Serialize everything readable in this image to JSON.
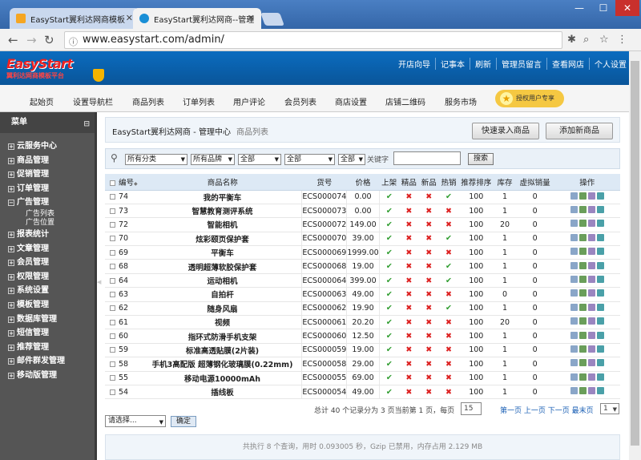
{
  "browser": {
    "tabs": [
      {
        "label": "EasyStart翼利达网商模板",
        "active": false
      },
      {
        "label": "EasyStart翼利达网商--管理",
        "active": true
      }
    ],
    "url": "www.easystart.com/admin/"
  },
  "header": {
    "logo_text": "EasyStart",
    "logo_sub": "翼利达网商模板平台",
    "links": [
      "开店向导",
      "记事本",
      "刷新",
      "管理员留言",
      "查看网店",
      "个人设置"
    ]
  },
  "menu": {
    "items": [
      "起始页",
      "设置导航栏",
      "商品列表",
      "订单列表",
      "用户评论",
      "会员列表",
      "商店设置",
      "店铺二维码",
      "服务市场"
    ],
    "vip_label": "授权用户专享"
  },
  "sidebar": {
    "title": "菜单",
    "items": [
      {
        "label": "云服务中心"
      },
      {
        "label": "商品管理"
      },
      {
        "label": "促销管理"
      },
      {
        "label": "订单管理"
      },
      {
        "label": "广告管理",
        "children": [
          "广告列表",
          "广告位置"
        ]
      },
      {
        "label": "报表统计"
      },
      {
        "label": "文章管理"
      },
      {
        "label": "会员管理"
      },
      {
        "label": "权限管理"
      },
      {
        "label": "系统设置"
      },
      {
        "label": "模板管理"
      },
      {
        "label": "数据库管理"
      },
      {
        "label": "短信管理"
      },
      {
        "label": "推荐管理"
      },
      {
        "label": "邮件群发管理"
      },
      {
        "label": "移动版管理"
      }
    ]
  },
  "page": {
    "title": "EasyStart翼利达网商 - 管理中心",
    "subtitle": "商品列表",
    "btn_quick": "快速录入商品",
    "btn_add": "添加新商品"
  },
  "filter": {
    "category": "所有分类",
    "brand": "所有品牌",
    "sel3": "全部",
    "sel4": "全部",
    "sel5": "全部",
    "keyword_label": "关键字",
    "keyword_value": "",
    "search_label": "搜索"
  },
  "table": {
    "headers": [
      "编号",
      "商品名称",
      "货号",
      "价格",
      "上架",
      "精品",
      "新品",
      "热销",
      "推荐排序",
      "库存",
      "虚拟销量",
      "操作"
    ],
    "rows": [
      {
        "id": "74",
        "name": "我的平衡车",
        "sn": "ECS000074",
        "price": "0.00",
        "onsale": true,
        "best": false,
        "new": false,
        "hot": true,
        "sort": "100",
        "stock": "1",
        "virtual": "0"
      },
      {
        "id": "73",
        "name": "智慧教育测评系统",
        "sn": "ECS000073",
        "price": "0.00",
        "onsale": true,
        "best": false,
        "new": false,
        "hot": false,
        "sort": "100",
        "stock": "1",
        "virtual": "0"
      },
      {
        "id": "72",
        "name": "智能相机",
        "sn": "ECS000072",
        "price": "149.00",
        "onsale": true,
        "best": false,
        "new": false,
        "hot": false,
        "sort": "100",
        "stock": "20",
        "virtual": "0"
      },
      {
        "id": "70",
        "name": "炫彩颐页保护套",
        "sn": "ECS000070",
        "price": "39.00",
        "onsale": true,
        "best": false,
        "new": false,
        "hot": true,
        "sort": "100",
        "stock": "1",
        "virtual": "0"
      },
      {
        "id": "69",
        "name": "平衡车",
        "sn": "ECS000069",
        "price": "1999.00",
        "onsale": true,
        "best": false,
        "new": false,
        "hot": false,
        "sort": "100",
        "stock": "1",
        "virtual": "0"
      },
      {
        "id": "68",
        "name": "透明超薄软胶保护套",
        "sn": "ECS000068",
        "price": "19.00",
        "onsale": true,
        "best": false,
        "new": false,
        "hot": true,
        "sort": "100",
        "stock": "1",
        "virtual": "0"
      },
      {
        "id": "64",
        "name": "运动相机",
        "sn": "ECS000064",
        "price": "399.00",
        "onsale": true,
        "best": false,
        "new": false,
        "hot": true,
        "sort": "100",
        "stock": "1",
        "virtual": "0"
      },
      {
        "id": "63",
        "name": "自拍杆",
        "sn": "ECS000063",
        "price": "49.00",
        "onsale": true,
        "best": false,
        "new": false,
        "hot": false,
        "sort": "100",
        "stock": "0",
        "virtual": "0"
      },
      {
        "id": "62",
        "name": "随身风扇",
        "sn": "ECS000062",
        "price": "19.90",
        "onsale": true,
        "best": false,
        "new": false,
        "hot": true,
        "sort": "100",
        "stock": "1",
        "virtual": "0"
      },
      {
        "id": "61",
        "name": "视频",
        "sn": "ECS000061",
        "price": "20.20",
        "onsale": true,
        "best": false,
        "new": false,
        "hot": false,
        "sort": "100",
        "stock": "20",
        "virtual": "0"
      },
      {
        "id": "60",
        "name": "指环式防滑手机支架",
        "sn": "ECS000060",
        "price": "12.50",
        "onsale": true,
        "best": false,
        "new": false,
        "hot": false,
        "sort": "100",
        "stock": "1",
        "virtual": "0"
      },
      {
        "id": "59",
        "name": "标准高透贴膜(2片装)",
        "sn": "ECS000059",
        "price": "19.00",
        "onsale": true,
        "best": false,
        "new": false,
        "hot": false,
        "sort": "100",
        "stock": "1",
        "virtual": "0"
      },
      {
        "id": "58",
        "name": "手机3高配版 超薄钢化玻璃膜(0.22mm)",
        "sn": "ECS000058",
        "price": "29.00",
        "onsale": true,
        "best": false,
        "new": false,
        "hot": false,
        "sort": "100",
        "stock": "1",
        "virtual": "0"
      },
      {
        "id": "55",
        "name": "移动电源10000mAh",
        "sn": "ECS000055",
        "price": "69.00",
        "onsale": true,
        "best": false,
        "new": false,
        "hot": false,
        "sort": "100",
        "stock": "1",
        "virtual": "0"
      },
      {
        "id": "54",
        "name": "插线板",
        "sn": "ECS000054",
        "price": "49.00",
        "onsale": true,
        "best": false,
        "new": false,
        "hot": false,
        "sort": "100",
        "stock": "1",
        "virtual": "0"
      }
    ]
  },
  "pager": {
    "info": "总计 40 个记录分为 3 页当前第 1 页，每页",
    "page_size": "15",
    "first": "第一页",
    "prev": "上一页",
    "next": "下一页",
    "last": "最末页",
    "current": "1"
  },
  "bulk": {
    "select_placeholder": "请选择...",
    "confirm": "确定"
  },
  "footer": {
    "text": "共执行 8 个查询，用时 0.093005 秒，Gzip 已禁用，内存占用 2.129 MB"
  },
  "colors": {
    "header_blue": "#0a5fa8",
    "sidebar_bg": "#555555",
    "check_green": "#2a9a2a",
    "cross_red": "#dd2222",
    "vip_yellow": "#f5c842"
  }
}
